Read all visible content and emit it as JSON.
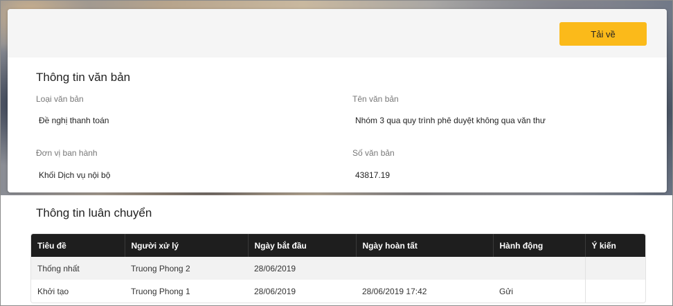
{
  "toolbar": {
    "download_label": "Tải về"
  },
  "document_info": {
    "title": "Thông tin văn bản",
    "fields": {
      "doc_type": {
        "label": "Loại văn bản",
        "value": "Đề nghị thanh toán"
      },
      "doc_name": {
        "label": "Tên văn bản",
        "value": "Nhóm 3 qua quy trình phê duyệt không qua văn thư"
      },
      "issuer": {
        "label": "Đơn vị ban hành",
        "value": "Khối Dịch vụ nội bộ"
      },
      "doc_number": {
        "label": "Số văn bản",
        "value": "43817.19"
      }
    }
  },
  "circulation": {
    "title": "Thông tin luân chuyển",
    "columns": [
      "Tiêu đề",
      "Người xử lý",
      "Ngày bắt đầu",
      "Ngày hoàn tất",
      "Hành động",
      "Ý kiến"
    ],
    "rows": [
      [
        "Thống nhất",
        "Truong Phong 2",
        "28/06/2019",
        "",
        "",
        ""
      ],
      [
        "Khởi tạo",
        "Truong Phong 1",
        "28/06/2019",
        "28/06/2019 17:42",
        "Gửi",
        ""
      ]
    ]
  },
  "colors": {
    "accent_button": "#fbba1a",
    "table_header": "#1e1e1e"
  }
}
